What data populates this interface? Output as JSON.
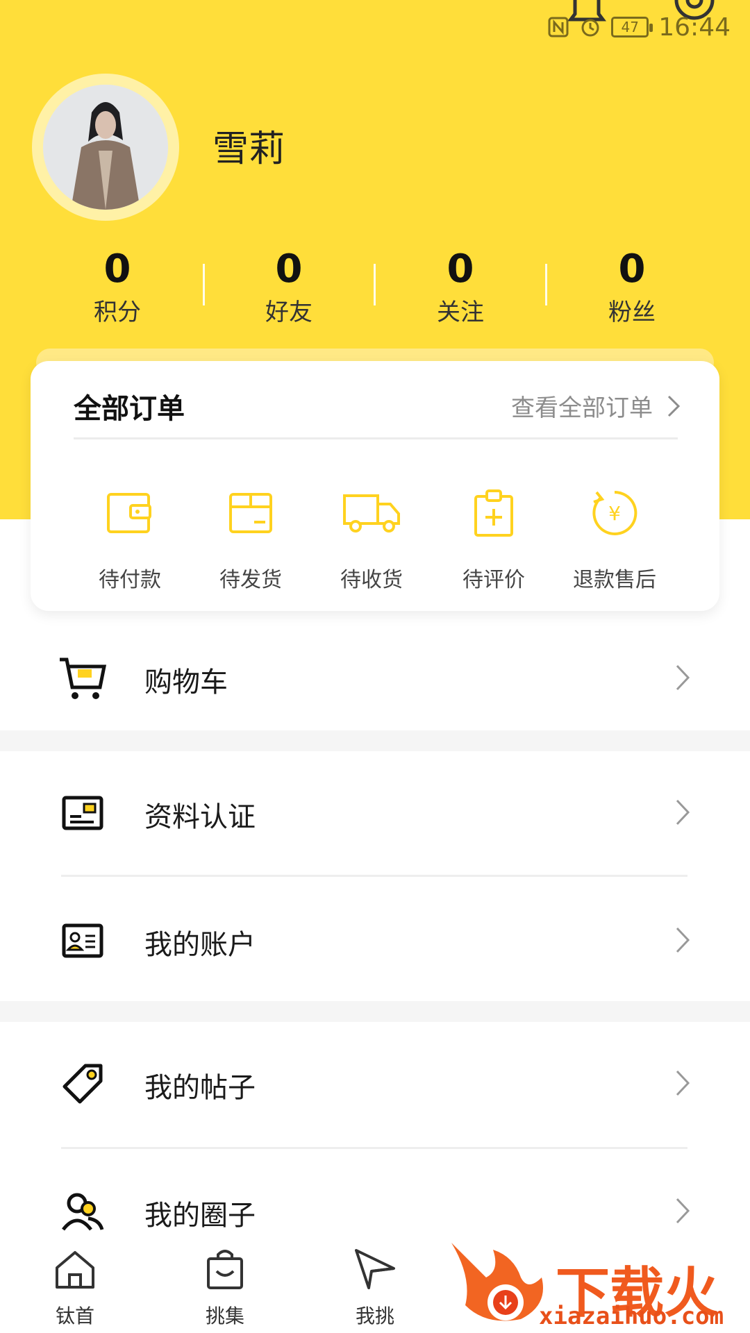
{
  "status_bar": {
    "battery": "47",
    "time": "16:44"
  },
  "profile": {
    "name": "雪莉"
  },
  "stats": [
    {
      "value": "0",
      "label": "积分"
    },
    {
      "value": "0",
      "label": "好友"
    },
    {
      "value": "0",
      "label": "关注"
    },
    {
      "value": "0",
      "label": "粉丝"
    }
  ],
  "orders": {
    "title": "全部订单",
    "view_all": "查看全部订单",
    "items": [
      {
        "label": "待付款",
        "icon": "wallet-icon"
      },
      {
        "label": "待发货",
        "icon": "box-icon"
      },
      {
        "label": "待收货",
        "icon": "truck-icon"
      },
      {
        "label": "待评价",
        "icon": "clipboard-plus-icon"
      },
      {
        "label": "退款售后",
        "icon": "refund-yen-icon"
      }
    ]
  },
  "menu": [
    {
      "label": "购物车",
      "icon": "cart-icon"
    },
    {
      "label": "资料认证",
      "icon": "id-card-icon"
    },
    {
      "label": "我的账户",
      "icon": "account-card-icon"
    },
    {
      "label": "我的帖子",
      "icon": "tag-icon"
    },
    {
      "label": "我的圈子",
      "icon": "group-icon"
    }
  ],
  "tabs": [
    {
      "label": "钛首",
      "icon": "home-icon"
    },
    {
      "label": "挑集",
      "icon": "shopping-bag-icon"
    },
    {
      "label": "我挑",
      "icon": "paper-plane-icon"
    }
  ],
  "watermark": {
    "brand": "下载火",
    "url": "xiazaihuo.com"
  },
  "colors": {
    "accent": "#FFDE3A",
    "icon_yellow": "#FFD21F",
    "text": "#111111"
  }
}
